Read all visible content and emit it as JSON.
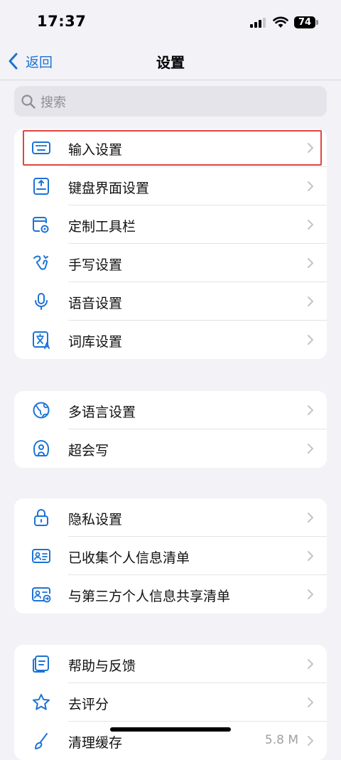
{
  "status": {
    "time": "17:37",
    "battery": "74"
  },
  "nav": {
    "back_label": "返回",
    "title": "设置"
  },
  "search": {
    "placeholder": "搜索"
  },
  "colors": {
    "accent": "#1b73d6",
    "background": "#f2f2f7",
    "highlight": "#e0463f"
  },
  "groups": [
    {
      "items": [
        {
          "label": "输入设置",
          "icon": "keyboard-icon"
        },
        {
          "label": "键盘界面设置",
          "icon": "keyboard-layout-icon"
        },
        {
          "label": "定制工具栏",
          "icon": "toolbar-gear-icon"
        },
        {
          "label": "手写设置",
          "icon": "handwriting-icon"
        },
        {
          "label": "语音设置",
          "icon": "microphone-icon"
        },
        {
          "label": "词库设置",
          "icon": "dictionary-icon"
        }
      ]
    },
    {
      "items": [
        {
          "label": "多语言设置",
          "icon": "globe-icon"
        },
        {
          "label": "超会写",
          "icon": "writer-icon"
        }
      ]
    },
    {
      "items": [
        {
          "label": "隐私设置",
          "icon": "lock-icon"
        },
        {
          "label": "已收集个人信息清单",
          "icon": "id-card-icon"
        },
        {
          "label": "与第三方个人信息共享清单",
          "icon": "id-card-share-icon"
        }
      ]
    },
    {
      "items": [
        {
          "label": "帮助与反馈",
          "icon": "feedback-icon"
        },
        {
          "label": "去评分",
          "icon": "star-icon"
        },
        {
          "label": "清理缓存",
          "icon": "brush-icon",
          "value": "5.8 M"
        }
      ]
    }
  ]
}
